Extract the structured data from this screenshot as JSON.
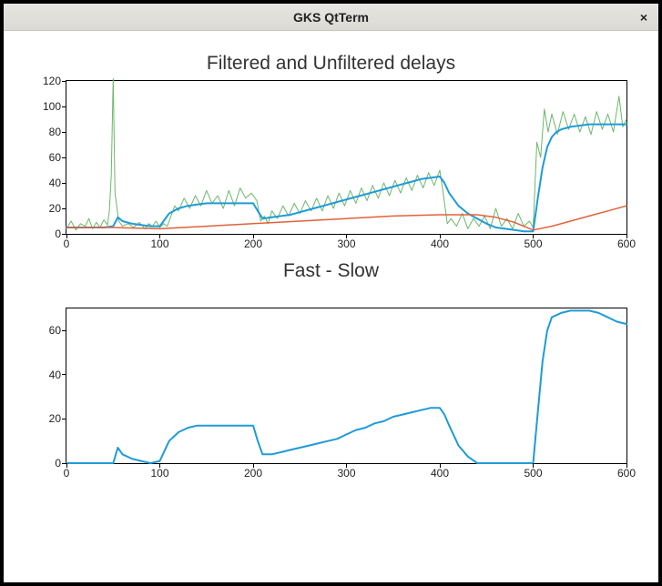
{
  "window": {
    "title": "GKS QtTerm",
    "close_label": "×"
  },
  "chart_data": [
    {
      "id": "top",
      "type": "line",
      "title": "Filtered and Unfiltered delays",
      "xlabel": "",
      "ylabel": "",
      "xlim": [
        0,
        600
      ],
      "ylim": [
        0,
        120
      ],
      "yticks": [
        0,
        20,
        40,
        60,
        80,
        100,
        120
      ],
      "xticks": [
        0,
        100,
        200,
        300,
        400,
        500,
        600
      ],
      "series": [
        {
          "name": "unfiltered",
          "color": "#6ab86a",
          "width": 1,
          "x": [
            0,
            5,
            10,
            15,
            20,
            24,
            28,
            32,
            36,
            40,
            44,
            46,
            48,
            50,
            52,
            56,
            60,
            66,
            72,
            78,
            84,
            88,
            92,
            96,
            100,
            104,
            108,
            112,
            116,
            120,
            126,
            132,
            138,
            144,
            150,
            156,
            162,
            168,
            174,
            180,
            186,
            192,
            198,
            204,
            208,
            212,
            216,
            220,
            226,
            232,
            238,
            244,
            250,
            256,
            262,
            268,
            274,
            280,
            286,
            292,
            298,
            304,
            310,
            316,
            322,
            328,
            334,
            340,
            346,
            352,
            358,
            364,
            370,
            376,
            382,
            388,
            394,
            400,
            404,
            408,
            412,
            418,
            424,
            430,
            436,
            442,
            448,
            454,
            460,
            466,
            472,
            478,
            484,
            490,
            496,
            500,
            504,
            508,
            512,
            516,
            520,
            526,
            532,
            538,
            544,
            550,
            556,
            562,
            568,
            574,
            580,
            586,
            592,
            596,
            600
          ],
          "y": [
            4,
            10,
            3,
            8,
            6,
            12,
            4,
            9,
            5,
            11,
            7,
            18,
            46,
            122,
            32,
            10,
            6,
            8,
            5,
            9,
            4,
            8,
            6,
            10,
            5,
            8,
            6,
            14,
            22,
            18,
            28,
            20,
            30,
            22,
            34,
            24,
            30,
            20,
            34,
            22,
            36,
            28,
            32,
            26,
            10,
            14,
            8,
            18,
            12,
            22,
            14,
            24,
            16,
            26,
            18,
            28,
            18,
            30,
            20,
            32,
            22,
            34,
            24,
            36,
            26,
            38,
            28,
            40,
            30,
            42,
            32,
            44,
            34,
            46,
            36,
            48,
            38,
            50,
            30,
            8,
            12,
            6,
            16,
            4,
            12,
            6,
            14,
            4,
            20,
            6,
            12,
            4,
            16,
            6,
            10,
            5,
            72,
            60,
            98,
            80,
            94,
            78,
            96,
            82,
            94,
            80,
            92,
            78,
            96,
            82,
            94,
            80,
            108,
            84,
            90
          ]
        },
        {
          "name": "filtered",
          "color": "#1f9bd8",
          "width": 2,
          "x": [
            0,
            20,
            40,
            50,
            55,
            60,
            70,
            80,
            90,
            100,
            110,
            120,
            130,
            140,
            150,
            160,
            170,
            180,
            190,
            200,
            205,
            210,
            220,
            230,
            240,
            250,
            260,
            270,
            280,
            290,
            300,
            310,
            320,
            330,
            340,
            350,
            360,
            370,
            380,
            390,
            400,
            405,
            410,
            420,
            430,
            440,
            450,
            460,
            470,
            480,
            490,
            500,
            505,
            510,
            515,
            520,
            525,
            530,
            540,
            550,
            560,
            570,
            580,
            590,
            600
          ],
          "y": [
            5,
            5,
            5,
            6,
            13,
            10,
            8,
            7,
            6,
            6,
            16,
            20,
            22,
            23,
            24,
            24,
            24,
            24,
            24,
            24,
            18,
            12,
            13,
            14,
            15,
            17,
            19,
            21,
            23,
            25,
            27,
            29,
            31,
            33,
            35,
            37,
            39,
            41,
            43,
            44,
            45,
            40,
            32,
            22,
            16,
            12,
            8,
            5,
            4,
            3,
            2,
            2,
            28,
            52,
            68,
            76,
            80,
            82,
            84,
            85,
            86,
            86,
            86,
            86,
            86
          ]
        },
        {
          "name": "slow",
          "color": "#e0623a",
          "width": 1.5,
          "x": [
            0,
            50,
            100,
            150,
            200,
            250,
            300,
            350,
            400,
            420,
            440,
            460,
            480,
            500,
            520,
            540,
            560,
            580,
            600
          ],
          "y": [
            5,
            5,
            4,
            6,
            8,
            10,
            12,
            14,
            15,
            15,
            15,
            13,
            9,
            3,
            6,
            10,
            14,
            18,
            22
          ]
        }
      ]
    },
    {
      "id": "bot",
      "type": "line",
      "title": "Fast - Slow",
      "xlabel": "",
      "ylabel": "",
      "xlim": [
        0,
        600
      ],
      "ylim": [
        0,
        70
      ],
      "yticks": [
        0,
        20,
        40,
        60
      ],
      "xticks": [
        0,
        100,
        200,
        300,
        400,
        500,
        600
      ],
      "series": [
        {
          "name": "diff",
          "color": "#1f9bd8",
          "width": 2,
          "x": [
            0,
            20,
            40,
            50,
            55,
            60,
            70,
            80,
            90,
            100,
            110,
            120,
            130,
            140,
            150,
            160,
            170,
            180,
            190,
            200,
            205,
            210,
            220,
            230,
            240,
            250,
            260,
            270,
            280,
            290,
            300,
            310,
            320,
            330,
            340,
            350,
            360,
            370,
            380,
            390,
            400,
            405,
            410,
            420,
            430,
            440,
            450,
            460,
            470,
            480,
            490,
            500,
            505,
            510,
            515,
            520,
            525,
            530,
            540,
            550,
            560,
            570,
            580,
            590,
            600
          ],
          "y": [
            0,
            0,
            0,
            0,
            7,
            4,
            2,
            1,
            0,
            1,
            10,
            14,
            16,
            17,
            17,
            17,
            17,
            17,
            17,
            17,
            10,
            4,
            4,
            5,
            6,
            7,
            8,
            9,
            10,
            11,
            13,
            15,
            16,
            18,
            19,
            21,
            22,
            23,
            24,
            25,
            25,
            22,
            17,
            8,
            3,
            0,
            0,
            0,
            0,
            0,
            0,
            0,
            23,
            46,
            60,
            66,
            67,
            68,
            69,
            69,
            69,
            68,
            66,
            64,
            63
          ]
        }
      ]
    }
  ]
}
